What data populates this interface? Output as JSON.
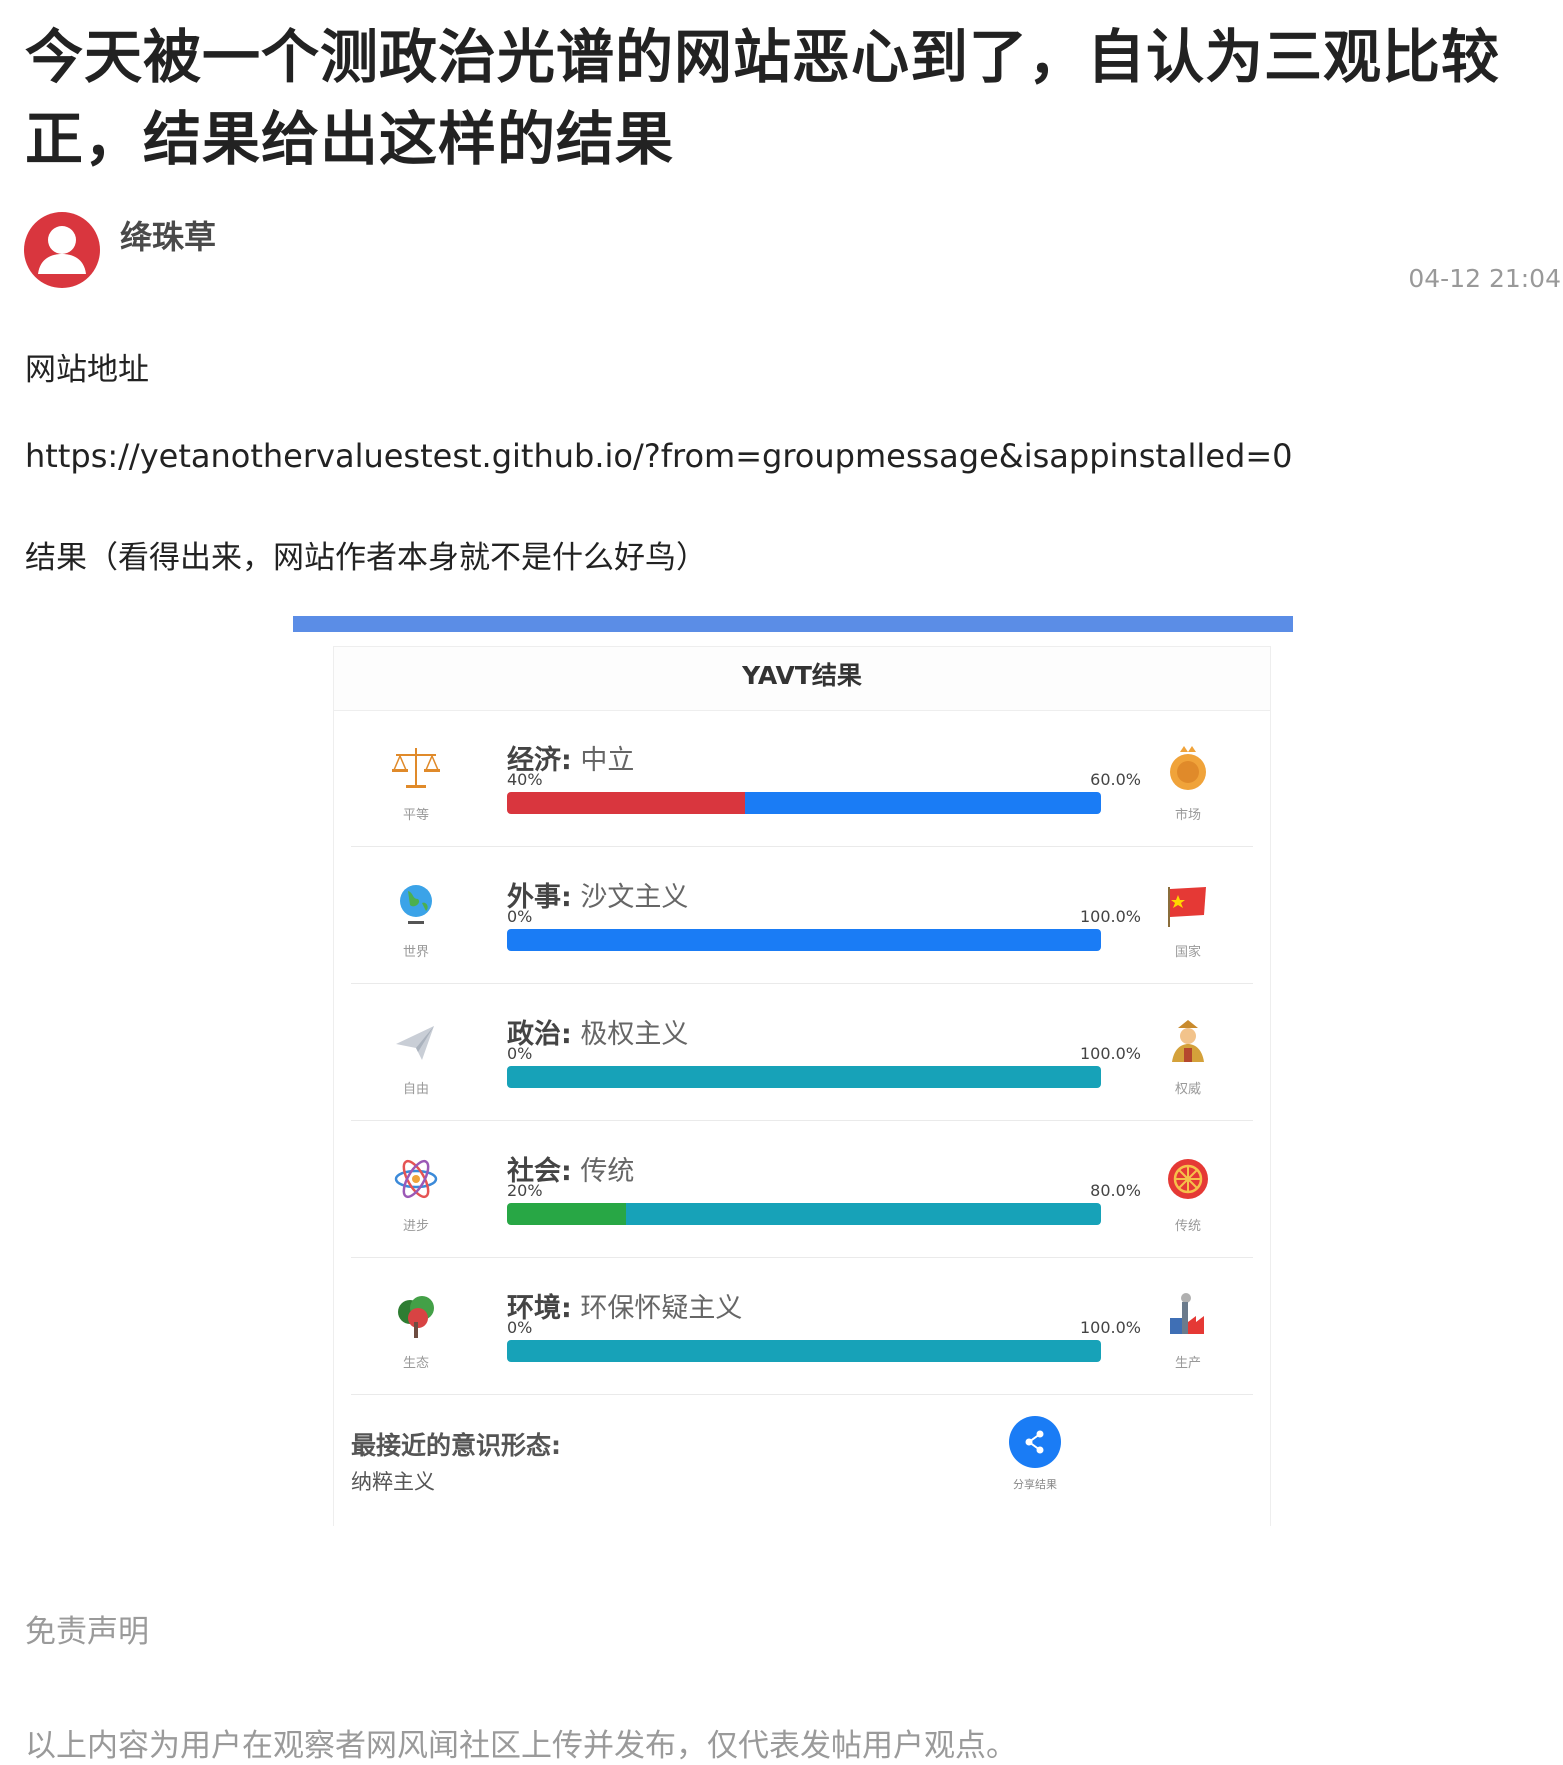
{
  "post": {
    "title": "今天被一个测政治光谱的网站恶心到了，自认为三观比较正，结果给出这样的结果",
    "author": "绛珠草",
    "time": "04-12 21:04",
    "paragraphs": [
      "网站地址",
      "https://yetanothervaluestest.github.io/?from=groupmessage&isappinstalled=0",
      "结果（看得出来，网站作者本身就不是什么好鸟）"
    ]
  },
  "result": {
    "header": "YAVT结果",
    "axes": [
      {
        "key": "经济:",
        "value": "中立",
        "left_label": "平等",
        "right_label": "市场",
        "left_pct": "40%",
        "right_pct": "60.0%",
        "left_fraction": 0.4,
        "left_color": "#d9363e",
        "right_color": "#1a7cf5",
        "left_icon": "scales-icon",
        "right_icon": "coin-icon"
      },
      {
        "key": "外事:",
        "value": "沙文主义",
        "left_label": "世界",
        "right_label": "国家",
        "left_pct": "0%",
        "right_pct": "100.0%",
        "left_fraction": 0.0,
        "left_color": "#1a7cf5",
        "right_color": "#1a7cf5",
        "left_icon": "globe-icon",
        "right_icon": "flag-icon"
      },
      {
        "key": "政治:",
        "value": "极权主义",
        "left_label": "自由",
        "right_label": "权威",
        "left_pct": "0%",
        "right_pct": "100.0%",
        "left_fraction": 0.0,
        "left_color": "#17a2b8",
        "right_color": "#17a2b8",
        "left_icon": "paper-plane-icon",
        "right_icon": "emperor-icon"
      },
      {
        "key": "社会:",
        "value": "传统",
        "left_label": "进步",
        "right_label": "传统",
        "left_pct": "20%",
        "right_pct": "80.0%",
        "left_fraction": 0.2,
        "left_color": "#28a745",
        "right_color": "#17a2b8",
        "left_icon": "atom-icon",
        "right_icon": "dharma-wheel-icon"
      },
      {
        "key": "环境:",
        "value": "环保怀疑主义",
        "left_label": "生态",
        "right_label": "生产",
        "left_pct": "0%",
        "right_pct": "100.0%",
        "left_fraction": 0.0,
        "left_color": "#17a2b8",
        "right_color": "#17a2b8",
        "left_icon": "tree-icon",
        "right_icon": "factory-icon"
      }
    ],
    "closest_label": "最接近的意识形态:",
    "closest_value": "纳粹主义",
    "share_label": "分享结果"
  },
  "disclaimer": {
    "title": "免责声明",
    "text": "以上内容为用户在观察者网风闻社区上传并发布，仅代表发帖用户观点。"
  },
  "colors": {
    "accent_bar": "#5b8de6",
    "avatar": "#d9363e",
    "share": "#1a7cf5"
  }
}
